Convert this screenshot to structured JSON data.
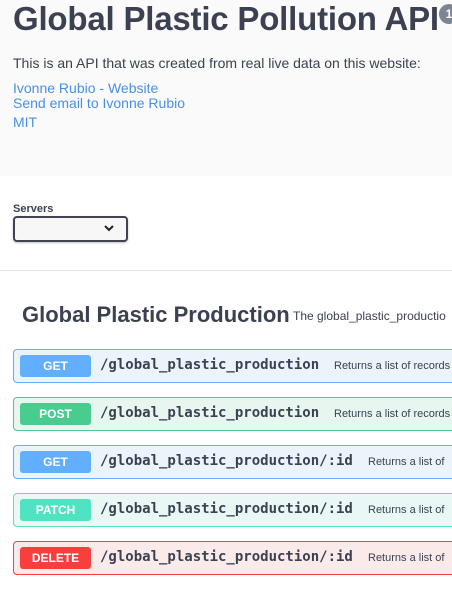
{
  "info": {
    "title": "Global Plastic Pollution API",
    "version_badge": "1",
    "description": "This is an API that was created from real live data on this website:",
    "links": {
      "website": "Ivonne Rubio - Website",
      "email": "Send email to Ivonne Rubio",
      "license": "MIT"
    }
  },
  "servers": {
    "label": "Servers",
    "selected": ""
  },
  "tag": {
    "name": "Global Plastic Production",
    "description": "The global_plastic_productio"
  },
  "operations": [
    {
      "method": "GET",
      "path": "/global_plastic_production",
      "summary": "Returns a list of records"
    },
    {
      "method": "POST",
      "path": "/global_plastic_production",
      "summary": "Returns a list of records"
    },
    {
      "method": "GET",
      "path": "/global_plastic_production/:id",
      "summary": "Returns a list of"
    },
    {
      "method": "PATCH",
      "path": "/global_plastic_production/:id",
      "summary": "Returns a list of"
    },
    {
      "method": "DELETE",
      "path": "/global_plastic_production/:id",
      "summary": "Returns a list of"
    }
  ],
  "colors": {
    "get": "#61affe",
    "post": "#49cc90",
    "patch": "#50e3c2",
    "delete": "#f93e3e",
    "link": "#4990e2",
    "text": "#3b4151"
  }
}
